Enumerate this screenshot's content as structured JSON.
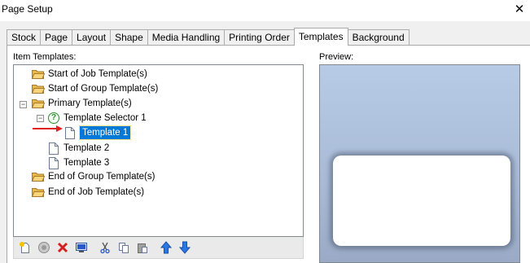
{
  "window": {
    "title": "Page Setup",
    "close_symbol": "✕"
  },
  "tabs": [
    {
      "label": "Stock",
      "active": false
    },
    {
      "label": "Page",
      "active": false
    },
    {
      "label": "Layout",
      "active": false
    },
    {
      "label": "Shape",
      "active": false
    },
    {
      "label": "Media Handling",
      "active": false
    },
    {
      "label": "Printing Order",
      "active": false
    },
    {
      "label": "Templates",
      "active": true
    },
    {
      "label": "Background",
      "active": false
    }
  ],
  "item_templates": {
    "label": "Item Templates:",
    "tree": [
      {
        "label": "Start of Job Template(s)",
        "icon": "folder-icon"
      },
      {
        "label": "Start of Group Template(s)",
        "icon": "folder-icon"
      },
      {
        "label": "Primary Template(s)",
        "icon": "folder-icon",
        "expander": "minus"
      },
      {
        "label": "Template Selector 1",
        "icon": "question-icon",
        "expander": "minus"
      },
      {
        "label": "Template 1",
        "icon": "page-icon",
        "selected": true
      },
      {
        "label": "Template 2",
        "icon": "page-icon"
      },
      {
        "label": "Template 3",
        "icon": "page-icon"
      },
      {
        "label": "End of Group Template(s)",
        "icon": "folder-icon"
      },
      {
        "label": "End of Job Template(s)",
        "icon": "folder-icon"
      }
    ],
    "toolbar": [
      "new-template-icon",
      "add-selector-icon",
      "delete-icon",
      "properties-icon",
      "cut-icon",
      "copy-icon",
      "paste-icon",
      "move-up-icon",
      "move-down-icon"
    ]
  },
  "preview": {
    "label": "Preview:"
  },
  "colors": {
    "selection": "#0078d7",
    "arrow": "#e02020",
    "folder": "#e8b84a"
  }
}
